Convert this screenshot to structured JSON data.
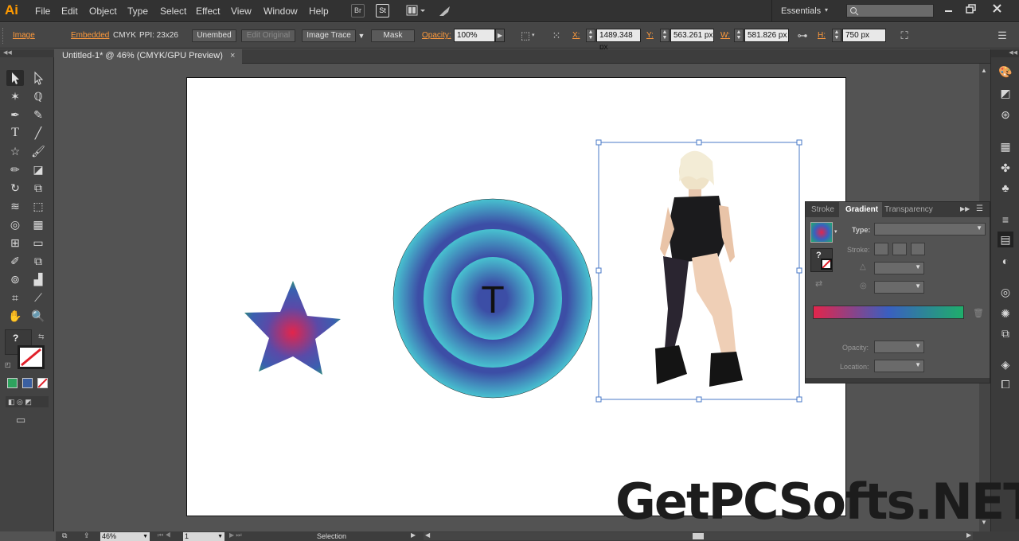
{
  "app": {
    "logo": "Ai"
  },
  "menu": [
    "File",
    "Edit",
    "Object",
    "Type",
    "Select",
    "Effect",
    "View",
    "Window",
    "Help"
  ],
  "menubar_buttons": {
    "br": "Br",
    "st": "St"
  },
  "workspace": {
    "label": "Essentials"
  },
  "control": {
    "object_type": "Image",
    "embedded": "Embedded",
    "color_mode": "CMYK",
    "ppi": "PPI: 23x26",
    "unembed": "Unembed",
    "edit_original": "Edit Original",
    "image_trace": "Image Trace",
    "mask": "Mask",
    "opacity_label": "Opacity:",
    "opacity_value": "100%",
    "x_label": "X:",
    "x_value": "1489.348 px",
    "y_label": "Y:",
    "y_value": "563.261 px",
    "w_label": "W:",
    "w_value": "581.826 px",
    "h_label": "H:",
    "h_value": "750 px"
  },
  "document": {
    "tab_title": "Untitled-1* @ 46% (CMYK/GPU Preview)",
    "close": "×"
  },
  "canvas": {
    "circle_text": "T"
  },
  "gradient_panel": {
    "tabs": [
      "Stroke",
      "Gradient",
      "Transparency"
    ],
    "type_label": "Type:",
    "stroke_label": "Stroke:",
    "opacity_label": "Opacity:",
    "location_label": "Location:",
    "unknown_swatch": "?",
    "gradient_stops": [
      "#e3254b",
      "#3a5fc0",
      "#1fae6b"
    ]
  },
  "status": {
    "zoom": "46%",
    "page": "1",
    "tool": "Selection"
  },
  "watermark": "GetPCSofts.NET",
  "colors": {
    "star_center": "#e3254b",
    "star_outer": "#2ea35e",
    "circle_outer": "#47c0cf",
    "circle_inner": "#3b4ea8",
    "selection": "#4a7ac7"
  }
}
